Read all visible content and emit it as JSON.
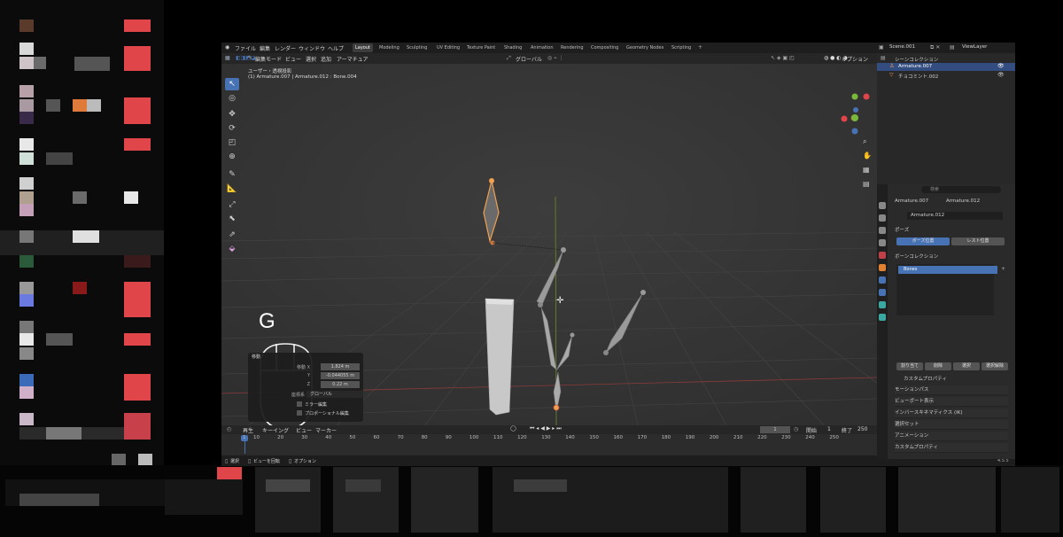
{
  "topbar": {
    "menus": [
      "ファイル",
      "編集",
      "レンダー",
      "ウィンドウ",
      "ヘルプ"
    ],
    "workspaces": [
      "Layout",
      "Modeling",
      "Sculpting",
      "UV Editing",
      "Texture Paint",
      "Shading",
      "Animation",
      "Rendering",
      "Compositing",
      "Geometry Nodes",
      "Scripting"
    ],
    "active_workspace": "Layout",
    "scene": "Scene.001",
    "view_layer": "ViewLayer"
  },
  "viewport_header": {
    "mode": "編集モード",
    "menus": [
      "ビュー",
      "選択",
      "追加",
      "アーマチュア"
    ],
    "transform_orientation": "グローバル",
    "options": "オプション"
  },
  "viewport": {
    "view_name": "ユーザー・透視投影",
    "active_object": "(1) Armature.007 | Armature.012 : Bone.004",
    "key_overlay": "G"
  },
  "last_operation": {
    "title": "移動",
    "fields": [
      {
        "label": "移動 X",
        "value": "1.824 m"
      },
      {
        "label": "Y",
        "value": "-0.044055 m"
      },
      {
        "label": "Z",
        "value": "0.22 m"
      }
    ],
    "orientation_label": "座標系",
    "orientation_value": "グローバル",
    "checks": [
      "ミラー編集",
      "プロポーショナル編集"
    ]
  },
  "outliner": {
    "title": "シーンコレクション",
    "items": [
      {
        "name": "Armature.007",
        "selected": true
      },
      {
        "name": "チョコミント.002",
        "selected": false
      }
    ]
  },
  "properties": {
    "search_placeholder": "検索",
    "breadcrumb": [
      "Armature.007",
      "Armature.012"
    ],
    "data_name": "Armature.012",
    "pose_header": "ポーズ",
    "pose_position": "ポーズ位置",
    "rest_position": "レスト位置",
    "bone_collection_header": "ボーンコレクション",
    "bones_item": "Bones",
    "buttons": [
      "割り当て",
      "削除",
      "選択",
      "選択解除"
    ],
    "subsection": "カスタムプロパティ",
    "panels": [
      "モーションパス",
      "ビューポート表示",
      "インバースキネマティクス (IK)",
      "選択セット",
      "アニメーション",
      "カスタムプロパティ"
    ]
  },
  "timeline": {
    "menus": [
      "再生",
      "キーイング",
      "ビュー",
      "マーカー"
    ],
    "current_frame": "1",
    "start_label": "開始",
    "start": "1",
    "end_label": "終了",
    "end": "250",
    "ticks": [
      "1",
      "10",
      "20",
      "30",
      "40",
      "50",
      "60",
      "70",
      "80",
      "90",
      "100",
      "110",
      "120",
      "130",
      "140",
      "150",
      "160",
      "170",
      "180",
      "190",
      "200",
      "210",
      "220",
      "230",
      "240",
      "250"
    ]
  },
  "statusbar": {
    "items": [
      "選択",
      "ビューを回転",
      "オプション"
    ],
    "version": "4.5.5"
  },
  "colors": {
    "accent": "#4772b3",
    "selected_bone": "#f0a050",
    "grid_x": "#8a3a3a",
    "grid_y": "#6b8a2a"
  }
}
